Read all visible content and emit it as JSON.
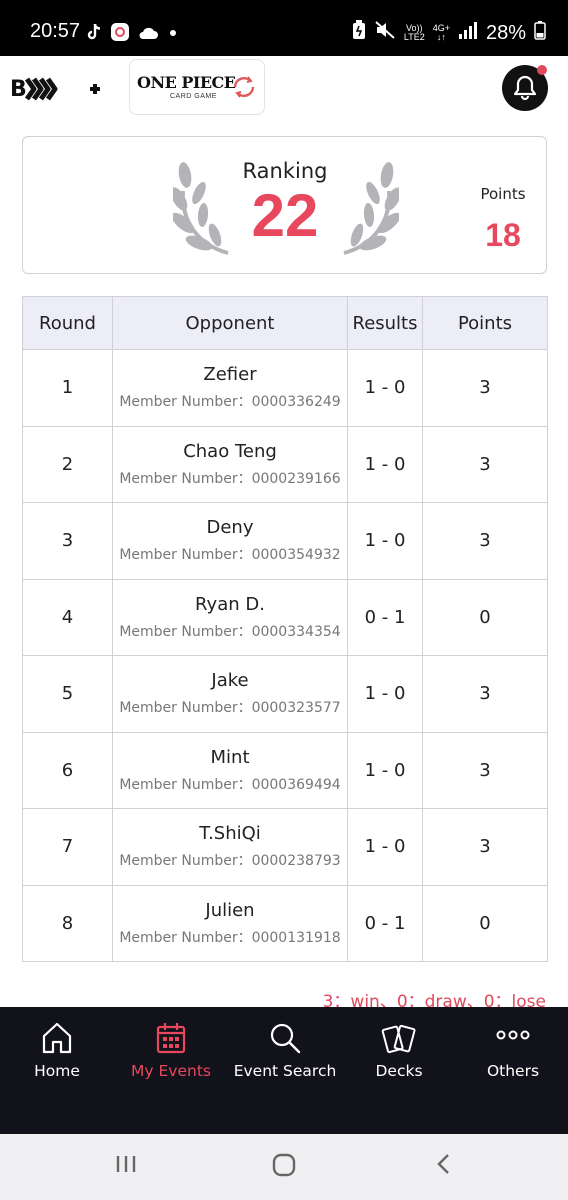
{
  "status_bar": {
    "time": "20:57",
    "battery": "28%",
    "network_top": "4G+",
    "volte_top": "Vo))",
    "volte_bottom": "LTE2",
    "arrows": "↓↑",
    "icons": [
      "tiktok-icon",
      "app-badge-icon",
      "cloud-icon",
      "dot-icon",
      "battery-saver-icon",
      "mute-icon",
      "signal-icon",
      "battery-icon"
    ]
  },
  "header": {
    "brand_logo": "B",
    "game_title": "ONE PIECE",
    "game_subtitle": "CARD GAME"
  },
  "ranking": {
    "label": "Ranking",
    "value": "22",
    "points_label": "Points",
    "points_value": "18"
  },
  "table": {
    "headers": [
      "Round",
      "Opponent",
      "Results",
      "Points"
    ],
    "member_prefix": "Member Number：",
    "rows": [
      {
        "round": "1",
        "name": "Zefier",
        "member": "Member Number：0000336249",
        "result": "1 - 0",
        "points": "3"
      },
      {
        "round": "2",
        "name": "Chao Teng",
        "member": "Member Number：0000239166",
        "result": "1 - 0",
        "points": "3"
      },
      {
        "round": "3",
        "name": "Deny",
        "member": "Member Number：0000354932",
        "result": "1 - 0",
        "points": "3"
      },
      {
        "round": "4",
        "name": "Ryan D.",
        "member": "Member Number：0000334354",
        "result": "0 - 1",
        "points": "0"
      },
      {
        "round": "5",
        "name": "Jake",
        "member": "Member Number：0000323577",
        "result": "1 - 0",
        "points": "3"
      },
      {
        "round": "6",
        "name": "Mint",
        "member": "Member Number：0000369494",
        "result": "1 - 0",
        "points": "3"
      },
      {
        "round": "7",
        "name": "T.ShiQi",
        "member": "Member Number：0000238793",
        "result": "1 - 0",
        "points": "3"
      },
      {
        "round": "8",
        "name": "Julien",
        "member": "Member Number：0000131918",
        "result": "0 - 1",
        "points": "0"
      }
    ]
  },
  "legend": "3：win、0：draw、0：lose",
  "nav": {
    "items": [
      {
        "label": "Home",
        "icon": "home-icon"
      },
      {
        "label": "My Events",
        "icon": "calendar-icon",
        "active": true
      },
      {
        "label": "Event Search",
        "icon": "search-icon"
      },
      {
        "label": "Decks",
        "icon": "cards-icon"
      },
      {
        "label": "Others",
        "icon": "more-icon"
      }
    ]
  },
  "colors": {
    "accent": "#e8485e",
    "nav_bg": "#12121a",
    "table_header_bg": "#ededf7"
  }
}
